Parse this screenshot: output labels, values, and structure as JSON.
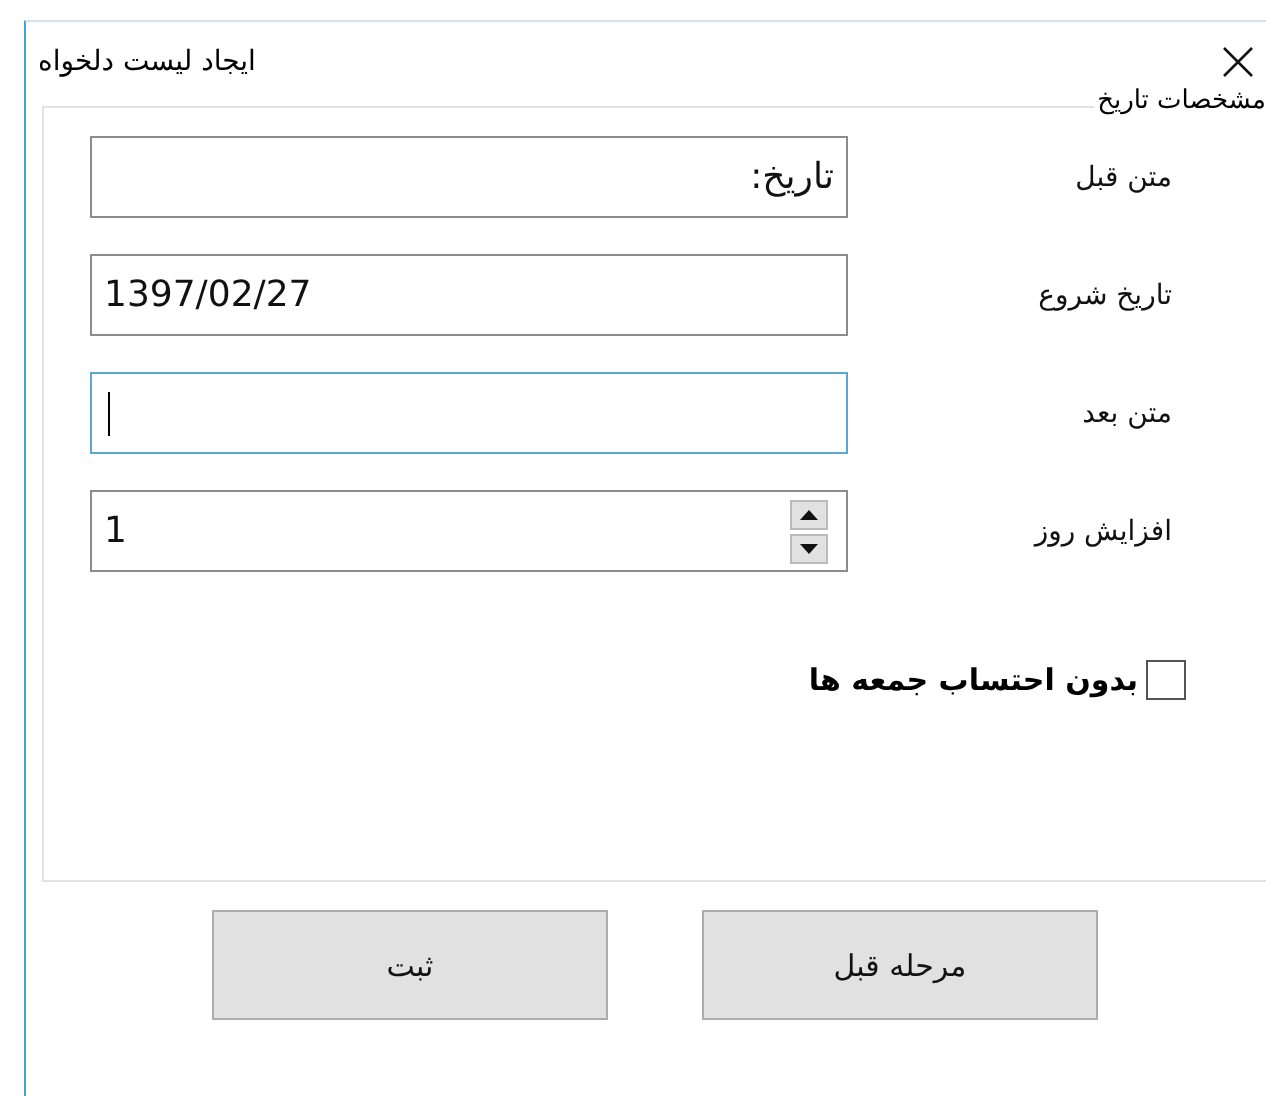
{
  "window": {
    "title": "ایجاد لیست دلخواه"
  },
  "group": {
    "legend": "مشخصات تاریخ",
    "fields": [
      {
        "kind": "text",
        "label": "متن قبل",
        "value": "تاریخ:",
        "focused": false
      },
      {
        "kind": "text",
        "label": "تاریخ شروع",
        "value": "1397/02/27",
        "focused": false
      },
      {
        "kind": "text",
        "label": "متن بعد",
        "focused": true
      },
      {
        "kind": "spin",
        "label": "افزایش روز",
        "value": "1",
        "focused": false
      }
    ],
    "checkbox": {
      "label": "بدون احتساب جمعه ها",
      "checked": false
    }
  },
  "buttons": [
    {
      "label": "مرحله قبل",
      "disabled": false
    },
    {
      "label": "ثبت",
      "disabled": false
    }
  ]
}
